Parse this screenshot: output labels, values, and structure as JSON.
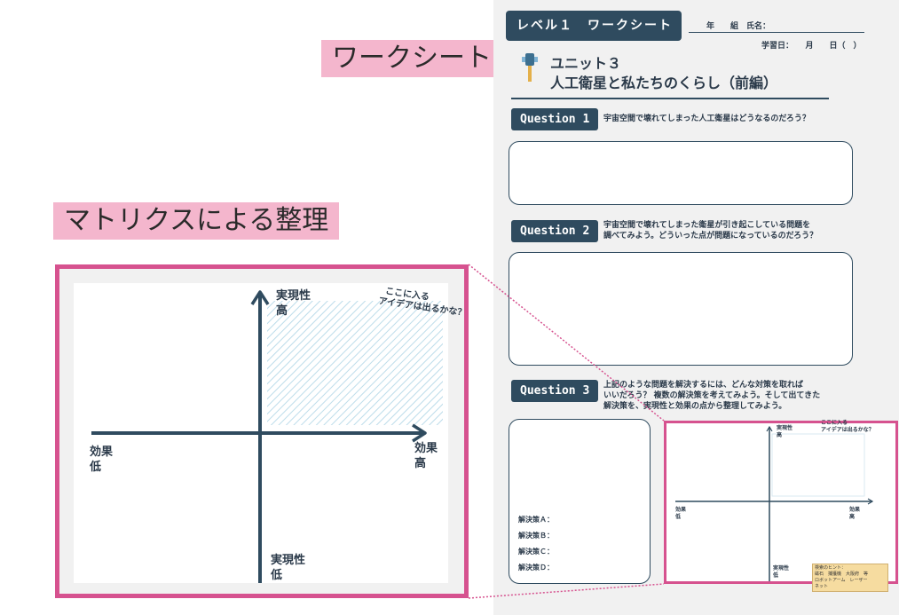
{
  "labels": {
    "worksheet": "ワークシート",
    "matrix": "マトリクスによる整理"
  },
  "worksheet": {
    "level_title": "レベル１　ワークシート",
    "grade_line": "年　　組　氏名：",
    "date_line": "学習日：　　月　　日（　）",
    "unit": "ユニット３",
    "title": "人工衛星と私たちのくらし（前編）",
    "questions": [
      {
        "tag": "Question 1",
        "lines": [
          "宇宙空間で壊れてしまった人工衛星はどうなるのだろう？"
        ]
      },
      {
        "tag": "Question 2",
        "lines": [
          "宇宙空間で壊れてしまった衛星が引き起こしている問題を",
          "調べてみよう。どういった点が問題になっているのだろう？"
        ]
      },
      {
        "tag": "Question 3",
        "lines": [
          "上記のような問題を解決するには、どんな対策を取れば",
          "いいだろう？ 複数の解決策を考えてみよう。そして出てきた",
          "解決策を、実現性と効果の点から整理してみよう。"
        ]
      }
    ],
    "solutions": [
      "解決策Ａ：",
      "解決策Ｂ：",
      "解決策Ｃ：",
      "解決策Ｄ："
    ],
    "hint_lines": [
      "検索のヒント：",
      "磁石　捕獲機　大阪府　等",
      "ロボットアーム　レーザー",
      "ネット"
    ]
  },
  "matrix": {
    "y_high": [
      "実現性",
      "高"
    ],
    "y_low": [
      "実現性",
      "低"
    ],
    "x_low": [
      "効果",
      "低"
    ],
    "x_high": [
      "効果",
      "高"
    ],
    "note": [
      "ここに入る",
      "アイデアは出るかな？"
    ]
  },
  "colors": {
    "navy": "#2f4b5f",
    "pink_label": "#f4b6cd",
    "magenta_frame": "#d6528f",
    "hatch": "#bcdcea"
  }
}
